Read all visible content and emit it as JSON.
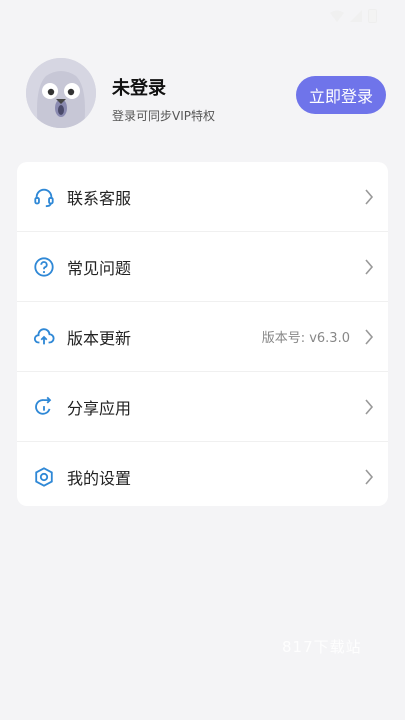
{
  "status_bar": {
    "time": "",
    "icons": [
      "wifi-icon",
      "signal-icon",
      "battery-icon"
    ]
  },
  "profile": {
    "name": "未登录",
    "subtitle": "登录可同步VIP特权",
    "login_button": "立即登录",
    "avatar": "owl-avatar"
  },
  "menu": {
    "items": [
      {
        "label": "联系客服",
        "icon": "headset-icon",
        "value": ""
      },
      {
        "label": "常见问题",
        "icon": "question-icon",
        "value": ""
      },
      {
        "label": "版本更新",
        "icon": "cloud-upload-icon",
        "value": "版本号: v6.3.0"
      },
      {
        "label": "分享应用",
        "icon": "share-icon",
        "value": ""
      },
      {
        "label": "我的设置",
        "icon": "settings-icon",
        "value": ""
      }
    ]
  },
  "watermark": "817下载站",
  "colors": {
    "accent": "#6f74ea",
    "icon": "#2f88d6",
    "background": "#f4f4f6"
  }
}
